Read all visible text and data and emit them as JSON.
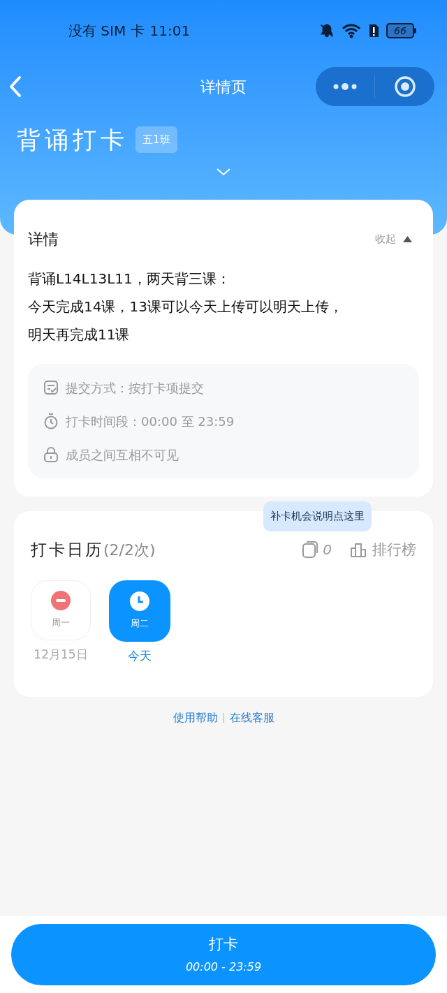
{
  "status_bar": {
    "carrier": "没有 SIM 卡",
    "time": "11:01",
    "battery": "66"
  },
  "nav": {
    "title": "详情页"
  },
  "header": {
    "title": "背诵打卡",
    "class_tag": "五1班"
  },
  "details": {
    "title": "详情",
    "collapse": "收起",
    "lines": [
      "背诵L14L13L11，两天背三课：",
      "今天完成14课，13课可以今天上传可以明天上传，",
      "明天再完成11课"
    ],
    "info": [
      {
        "kind": "submit",
        "text": "提交方式：按打卡项提交"
      },
      {
        "kind": "time",
        "text": "打卡时间段：00:00 至 23:59"
      },
      {
        "kind": "privacy",
        "text": "成员之间互相不可见"
      }
    ]
  },
  "calendar": {
    "title": "打卡日历",
    "count": "(2/2次)",
    "tooltip": "补卡机会说明点这里",
    "makeup_count": "0",
    "ranking": "排行榜",
    "days": [
      {
        "kind": "missed",
        "weekday": "周一",
        "date": "12月15日"
      },
      {
        "kind": "today",
        "weekday": "周二",
        "date": "今天"
      }
    ]
  },
  "links": [
    "使用帮助",
    "在线客服"
  ],
  "action": {
    "label": "打卡",
    "time": "00:00 - 23:59"
  }
}
